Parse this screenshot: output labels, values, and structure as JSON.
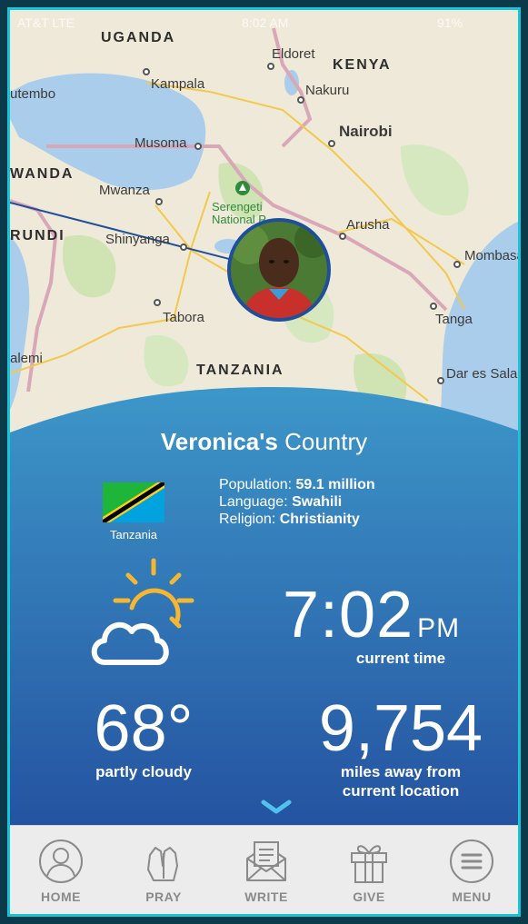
{
  "status_bar": {
    "carrier": "AT&T LTE",
    "time": "8:02 AM",
    "battery": "91%"
  },
  "map": {
    "labels": {
      "uganda": "UGANDA",
      "kenya": "KENYA",
      "tanzania": "TANZANIA",
      "rwanda": "WANDA",
      "burundi": "RUNDI",
      "eldoret": "Eldoret",
      "kampala": "Kampala",
      "nakuru": "Nakuru",
      "entebbe": "utembo",
      "nairobi": "Nairobi",
      "musoma": "Musoma",
      "mwanza": "Mwanza",
      "serengeti": "Serengeti National P",
      "arusha": "Arusha",
      "shinyanga": "Shinyanga",
      "mombasa": "Mombasa",
      "tabora": "Tabora",
      "tanga": "Tanga",
      "kalemie": "alemi",
      "dar": "Dar es Sala"
    }
  },
  "panel": {
    "title_name": "Veronica's",
    "title_suffix": " Country",
    "flag_label": "Tanzania",
    "population_label": "Population: ",
    "population_value": "59.1 million",
    "language_label": "Language: ",
    "language_value": "Swahili",
    "religion_label": "Religion: ",
    "religion_value": "Christianity",
    "time_value": "7:02",
    "time_ampm": "PM",
    "time_label": "current time",
    "temp_value": "68°",
    "temp_label": "partly cloudy",
    "distance_value": "9,754",
    "distance_label_1": "miles away from",
    "distance_label_2": "current location"
  },
  "tabs": [
    {
      "label": "HOME",
      "icon": "person-icon"
    },
    {
      "label": "PRAY",
      "icon": "praying-hands-icon"
    },
    {
      "label": "WRITE",
      "icon": "envelope-letter-icon"
    },
    {
      "label": "GIVE",
      "icon": "gift-icon"
    },
    {
      "label": "MENU",
      "icon": "menu-icon"
    }
  ],
  "colors": {
    "accent_frame": "#19c3d8",
    "panel_top": "#3d97c9",
    "panel_bottom": "#2452a0",
    "weather_sun": "#f5b731",
    "tab_gray": "#8a8a8a"
  }
}
